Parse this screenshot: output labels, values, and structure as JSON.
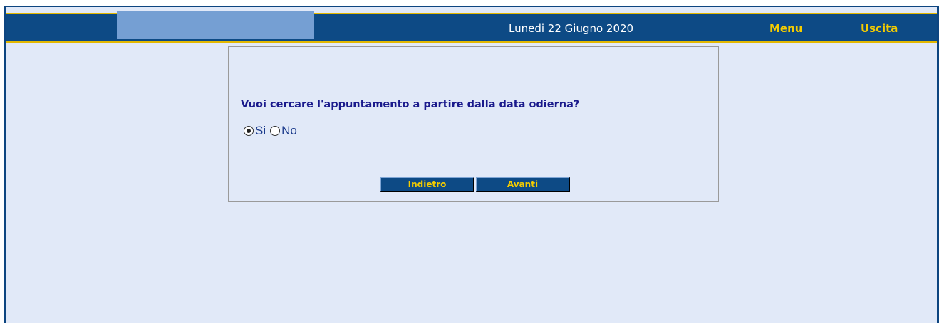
{
  "header": {
    "date": "Lunedi 22 Giugno 2020",
    "menu_label": "Menu",
    "exit_label": "Uscita"
  },
  "dialog": {
    "question": "Vuoi cercare l'appuntamento a partire dalla data odierna?",
    "options": [
      {
        "label": "Si",
        "selected": true
      },
      {
        "label": "No",
        "selected": false
      }
    ],
    "back_label": "Indietro",
    "next_label": "Avanti"
  },
  "colors": {
    "header_bg": "#0d4a85",
    "accent_yellow": "#f5cc00",
    "page_bg": "#e1e9f8",
    "logo_placeholder": "#759fd3",
    "question_text": "#1a1a8c"
  }
}
